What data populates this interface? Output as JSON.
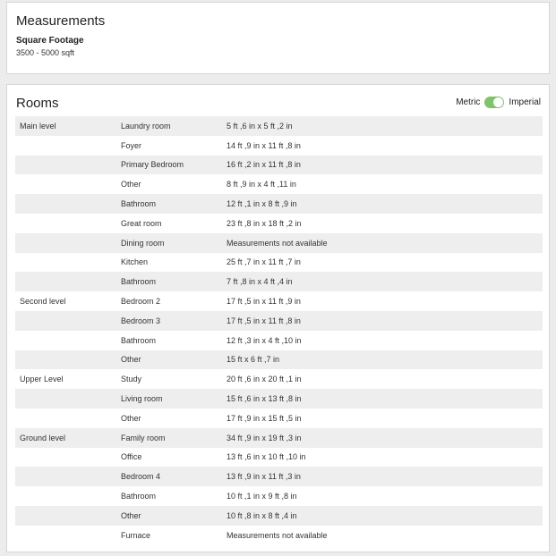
{
  "measurements": {
    "title": "Measurements",
    "square_footage_label": "Square Footage",
    "square_footage_value": "3500 - 5000 sqft"
  },
  "rooms": {
    "title": "Rooms",
    "unit_toggle": {
      "left_label": "Metric",
      "right_label": "Imperial",
      "selected": "Imperial",
      "accent_color": "#7fc36a"
    },
    "rows": [
      {
        "level": "Main level",
        "room": "Laundry room",
        "measurement": "5 ft ,6 in x 5 ft ,2 in"
      },
      {
        "level": "",
        "room": "Foyer",
        "measurement": "14 ft ,9 in x 11 ft ,8 in"
      },
      {
        "level": "",
        "room": "Primary Bedroom",
        "measurement": "16 ft ,2 in x 11 ft ,8 in"
      },
      {
        "level": "",
        "room": "Other",
        "measurement": "8 ft ,9 in x 4 ft ,11 in"
      },
      {
        "level": "",
        "room": "Bathroom",
        "measurement": "12 ft ,1 in x 8 ft ,9 in"
      },
      {
        "level": "",
        "room": "Great room",
        "measurement": "23 ft ,8 in x 18 ft ,2 in"
      },
      {
        "level": "",
        "room": "Dining room",
        "measurement": "Measurements not available"
      },
      {
        "level": "",
        "room": "Kitchen",
        "measurement": "25 ft ,7 in x 11 ft ,7 in"
      },
      {
        "level": "",
        "room": "Bathroom",
        "measurement": "7 ft ,8 in x 4 ft ,4 in"
      },
      {
        "level": "Second level",
        "room": "Bedroom 2",
        "measurement": "17 ft ,5 in x 11 ft ,9 in"
      },
      {
        "level": "",
        "room": "Bedroom 3",
        "measurement": "17 ft ,5 in x 11 ft ,8 in"
      },
      {
        "level": "",
        "room": "Bathroom",
        "measurement": "12 ft ,3 in x 4 ft ,10 in"
      },
      {
        "level": "",
        "room": "Other",
        "measurement": "15 ft x 6 ft ,7 in"
      },
      {
        "level": "Upper Level",
        "room": "Study",
        "measurement": "20 ft ,6 in x 20 ft ,1 in"
      },
      {
        "level": "",
        "room": "Living room",
        "measurement": "15 ft ,6 in x 13 ft ,8 in"
      },
      {
        "level": "",
        "room": "Other",
        "measurement": "17 ft ,9 in x 15 ft ,5 in"
      },
      {
        "level": "Ground level",
        "room": "Family room",
        "measurement": "34 ft ,9 in x 19 ft ,3 in"
      },
      {
        "level": "",
        "room": "Office",
        "measurement": "13 ft ,6 in x 10 ft ,10 in"
      },
      {
        "level": "",
        "room": "Bedroom 4",
        "measurement": "13 ft ,9 in x 11 ft ,3 in"
      },
      {
        "level": "",
        "room": "Bathroom",
        "measurement": "10 ft ,1 in x 9 ft ,8 in"
      },
      {
        "level": "",
        "room": "Other",
        "measurement": "10 ft ,8 in x 8 ft ,4 in"
      },
      {
        "level": "",
        "room": "Furnace",
        "measurement": "Measurements not available"
      }
    ]
  }
}
